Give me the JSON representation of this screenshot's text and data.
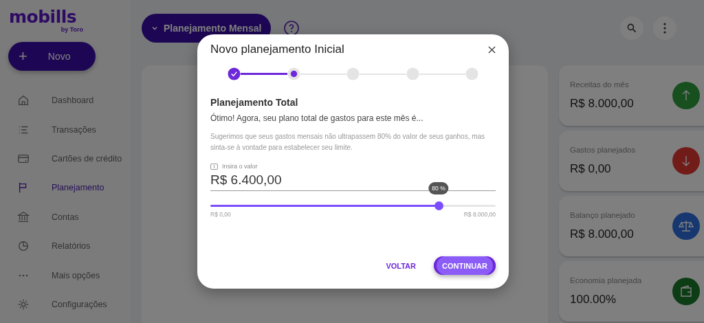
{
  "brand": {
    "name": "mobills",
    "tagline": "by Toro"
  },
  "new_button": {
    "icon": "+",
    "label": "Novo"
  },
  "sidebar": {
    "items": [
      {
        "label": "Dashboard",
        "selected": false
      },
      {
        "label": "Transações",
        "selected": false
      },
      {
        "label": "Cartões de crédito",
        "selected": false
      },
      {
        "label": "Planejamento",
        "selected": true
      },
      {
        "label": "Contas",
        "selected": false
      },
      {
        "label": "Relatórios",
        "selected": false
      },
      {
        "label": "Mais opções",
        "selected": false
      },
      {
        "label": "Configurações",
        "selected": false
      }
    ]
  },
  "header": {
    "period_button": "Planejamento Mensal"
  },
  "summary_cards": [
    {
      "label": "Receitas do mês",
      "value": "R$ 8.000,00"
    },
    {
      "label": "Gastos planejados",
      "value": "R$ 0,00"
    },
    {
      "label": "Balanço planejado",
      "value": "R$ 8.000,00"
    },
    {
      "label": "Economia planejada",
      "value": "100.00%"
    }
  ],
  "dialog": {
    "title": "Novo planejamento Inicial",
    "steps": [
      {
        "kind": "done"
      },
      {
        "kind": "current"
      },
      {
        "kind": "pending"
      },
      {
        "kind": "pending"
      },
      {
        "kind": "pending"
      }
    ],
    "heading": "Planejamento Total",
    "lead": "Ótimo! Agora, seu plano total de gastos para este mês é...",
    "hint": "Sugerimos que seus gastos mensais não ultrapassem 80% do valor de seus ganhos, mas sinta-se à vontade para estabelecer seu limite.",
    "field": {
      "label": "Insira o valor",
      "value": "R$ 6.400,00"
    },
    "slider": {
      "level": 0.8,
      "tooltip": "80 %",
      "min_label": "R$ 0,00",
      "max_label": "R$ 8.000,00"
    },
    "buttons": [
      {
        "label": "VOLTAR",
        "kind": "text"
      },
      {
        "label": "CONTINUAR",
        "kind": "primary"
      }
    ]
  }
}
